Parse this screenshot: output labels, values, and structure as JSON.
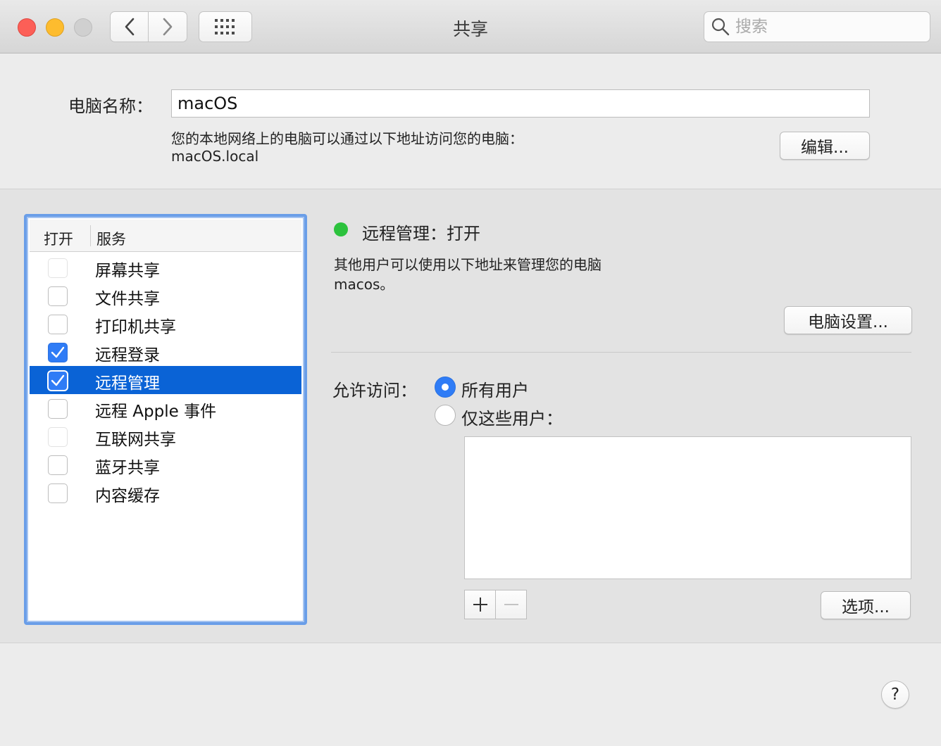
{
  "window": {
    "title": "共享",
    "search_placeholder": "搜索"
  },
  "computer_name": {
    "label": "电脑名称：",
    "value": "macOS",
    "address_note": "您的本地网络上的电脑可以通过以下地址访问您的电脑：",
    "address": "macOS.local",
    "edit_button": "编辑..."
  },
  "services": {
    "header_on": "打开",
    "header_service": "服务",
    "items": [
      {
        "label": "屏幕共享",
        "checked": false,
        "enabled": false
      },
      {
        "label": "文件共享",
        "checked": false,
        "enabled": true
      },
      {
        "label": "打印机共享",
        "checked": false,
        "enabled": true
      },
      {
        "label": "远程登录",
        "checked": true,
        "enabled": true
      },
      {
        "label": "远程管理",
        "checked": true,
        "enabled": true,
        "selected": true
      },
      {
        "label": "远程 Apple 事件",
        "checked": false,
        "enabled": true
      },
      {
        "label": "互联网共享",
        "checked": false,
        "enabled": false
      },
      {
        "label": "蓝牙共享",
        "checked": false,
        "enabled": true
      },
      {
        "label": "内容缓存",
        "checked": false,
        "enabled": true
      }
    ]
  },
  "detail": {
    "status": "远程管理：打开",
    "status_color": "#2cc23d",
    "description": "其他用户可以使用以下地址来管理您的电脑",
    "host": "macos。",
    "computer_settings_button": "电脑设置...",
    "access_label": "允许访问：",
    "radio_all": "所有用户",
    "radio_only": "仅这些用户：",
    "selected_access": "所有用户",
    "options_button": "选项...",
    "help": "?"
  },
  "colors": {
    "accent": "#2f7cf6",
    "selection": "#0a63d6",
    "list_focus_ring": "#6a9ee8"
  }
}
